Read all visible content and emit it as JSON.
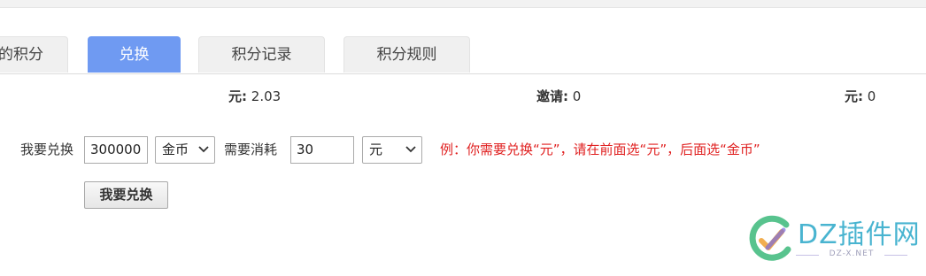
{
  "tabs": [
    {
      "label": "的积分",
      "active": false
    },
    {
      "label": "兑换",
      "active": true
    },
    {
      "label": "积分记录",
      "active": false
    },
    {
      "label": "积分规则",
      "active": false
    }
  ],
  "stats": [
    {
      "label": "元:",
      "value": "2.03"
    },
    {
      "label": "邀请:",
      "value": "0"
    },
    {
      "label": "元:",
      "value": "0"
    }
  ],
  "exchange": {
    "want_label": "我要兑换",
    "want_amount": "300000",
    "want_unit": "金币",
    "cost_label": "需要消耗",
    "cost_amount": "30",
    "cost_unit": "元",
    "example": "例：你需要兑换“元”，请在前面选“元”，后面选“金币”",
    "submit_label": "我要兑换"
  },
  "watermark": {
    "text": "DZ插件网",
    "sub": "DZ-X.NET"
  },
  "colors": {
    "active_tab": "#6f9af2",
    "example_text": "#e02020"
  }
}
